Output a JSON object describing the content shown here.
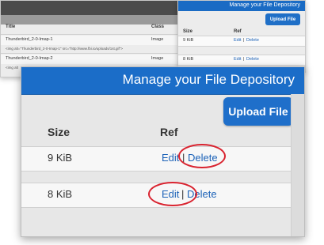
{
  "background_left": {
    "columns": {
      "title": "Title",
      "class": "Class"
    },
    "rows": [
      {
        "title": "Thunderbird_2-0-Imap-1",
        "class": "Image",
        "code": "<img alt=\"Thunderbird_2-0-Imap-1\" src=\"http://www.fbi.io/uploads/1st.gif\">"
      },
      {
        "title": "Thunderbird_2-0-Imap-2",
        "class": "Image",
        "code": "<img alt"
      }
    ]
  },
  "background_right": {
    "title": "Manage your File Depository",
    "upload_label": "Upload File",
    "columns": {
      "size": "Size",
      "ref": "Ref"
    },
    "rows": [
      {
        "size": "9 KiB",
        "edit": "Edit",
        "sep": "|",
        "delete": "Delete"
      },
      {
        "size": "8 KiB",
        "edit": "Edit",
        "sep": "|",
        "delete": "Delete"
      }
    ]
  },
  "main": {
    "title": "Manage your File Depository",
    "upload_label": "Upload File",
    "columns": {
      "size": "Size",
      "ref": "Ref"
    },
    "rows": [
      {
        "size": "9 KiB",
        "edit": "Edit",
        "sep": "|",
        "delete": "Delete",
        "highlight": "delete"
      },
      {
        "size": "8 KiB",
        "edit": "Edit",
        "sep": "|",
        "delete": "Delete",
        "highlight": "edit"
      }
    ]
  },
  "colors": {
    "header_blue": "#1b6dc8",
    "link_blue": "#1d63b8",
    "highlight_red": "#d9232f"
  }
}
